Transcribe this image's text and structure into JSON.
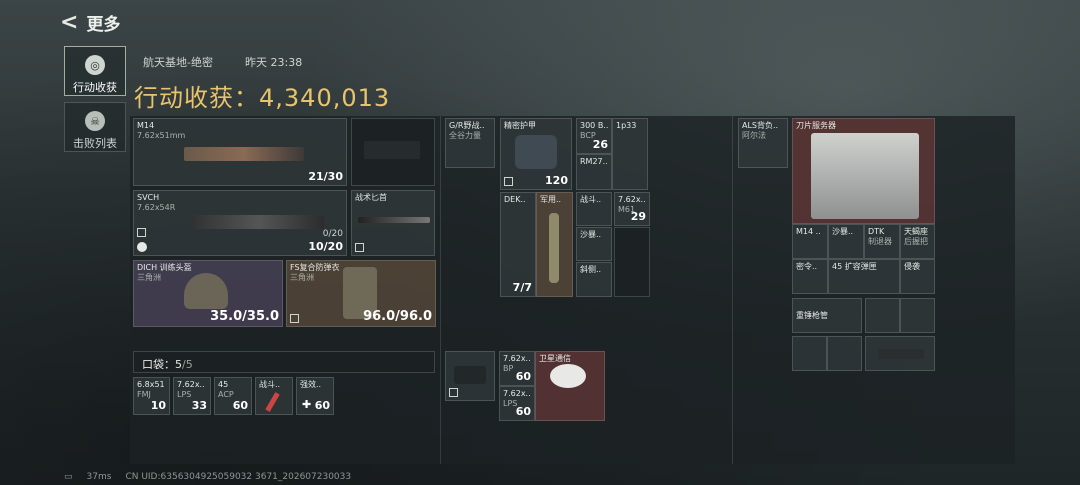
{
  "header": {
    "back_icon": "back-arrow-icon",
    "title": "更多"
  },
  "side_tabs": [
    {
      "label": "行动收获",
      "icon": "loot-icon",
      "active": true
    },
    {
      "label": "击败列表",
      "icon": "skull-icon",
      "active": false
    }
  ],
  "meta": {
    "map": "航天基地-绝密",
    "time": "昨天 23:38"
  },
  "summary": {
    "label": "行动收获：",
    "value": "4,340,013"
  },
  "weapons": {
    "primary1": {
      "name": "M14",
      "caliber": "7.62x51mm",
      "ammo": "21/30"
    },
    "primary2": {
      "name": "SVCH",
      "caliber": "7.62x54R",
      "ammo_a": "0/20",
      "ammo_b": "10/20"
    },
    "melee": {
      "name": "战术匕首"
    },
    "helmet": {
      "name": "DICH 训练头盔",
      "sub": "三角洲",
      "dur": "35.0/35.0"
    },
    "armor": {
      "name": "FS复合防弹衣",
      "sub": "三角洲",
      "dur": "96.0/96.0"
    }
  },
  "pocket": {
    "label": "口袋：",
    "count": "5",
    "cap": "/5",
    "items": [
      {
        "name": "6.8x51",
        "sub": "FMJ",
        "n": "10"
      },
      {
        "name": "7.62x..",
        "sub": "LPS",
        "n": "33"
      },
      {
        "name": "45",
        "sub": "ACP",
        "n": "60"
      },
      {
        "name": "战斗..",
        "sub": "",
        "n": ""
      },
      {
        "name": "强效..",
        "sub": "",
        "n": "60"
      }
    ]
  },
  "chest": {
    "rig": "G/R野战..",
    "rig_sub": "全谷力量",
    "vest": "精密护甲",
    "vest_n": "120",
    "items": [
      {
        "name": "300 B..",
        "sub": "BCP",
        "n": "26"
      },
      {
        "name": "1p33",
        "sub": ""
      },
      {
        "name": "RM27..",
        "sub": ""
      },
      {
        "name": "DEK..",
        "n": "7/7"
      },
      {
        "name": "军用.."
      },
      {
        "name": "战斗.."
      },
      {
        "name": "7.62x..",
        "sub": "M61",
        "n": "29"
      },
      {
        "name": "沙暴.."
      },
      {
        "name": "斜侧.."
      }
    ]
  },
  "backpack": {
    "items": [
      {
        "name": "7.62x..",
        "sub": "BP",
        "n": "60"
      },
      {
        "name": "7.62x..",
        "sub": "LPS",
        "n": "60"
      },
      {
        "name": "卫星通信"
      }
    ]
  },
  "safe": {
    "name": "ALS背负..",
    "sub": "阿尔法",
    "server": "刀片服务器",
    "items": [
      {
        "name": "M14 .."
      },
      {
        "name": "沙暴.."
      },
      {
        "name": "DTK",
        "sub": "制退器"
      },
      {
        "name": "天蝎座",
        "sub": "后握把"
      },
      {
        "name": "密令.."
      },
      {
        "name": "45 扩容弹匣"
      },
      {
        "name": "侵袭"
      },
      {
        "name": "重锤枪管"
      }
    ]
  },
  "footer": {
    "ping": "37ms",
    "uid": "CN UID:6356304925059032 3671_202607230033"
  },
  "colors": {
    "gold": "#e8c56a",
    "brown": "#58483a",
    "purple": "#484258",
    "red": "#603636"
  }
}
